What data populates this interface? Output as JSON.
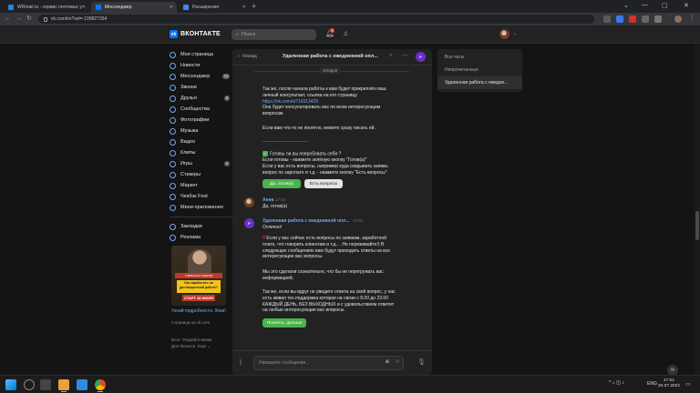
{
  "browser": {
    "tabs": [
      {
        "label": "WRmail.ru - сервис почтовых у",
        "active": false,
        "color": "#1e88e5"
      },
      {
        "label": "Мессенджер",
        "active": true,
        "color": "#0077ff"
      },
      {
        "label": "Расширения",
        "active": false,
        "color": "#4285f4"
      }
    ],
    "new_tab": "+",
    "url": "vk.com/im?sel=-199827354",
    "window_controls": [
      "—",
      "▢",
      "✕"
    ]
  },
  "vk_header": {
    "logo": "ВКОНТАКТЕ",
    "search_placeholder": "Поиск",
    "notifications_count": "1"
  },
  "sidebar": {
    "items": [
      {
        "label": "Моя страница",
        "badge": ""
      },
      {
        "label": "Новости",
        "badge": ""
      },
      {
        "label": "Мессенджер",
        "badge": "74"
      },
      {
        "label": "Звонки",
        "badge": ""
      },
      {
        "label": "Друзья",
        "badge": "8"
      },
      {
        "label": "Сообщества",
        "badge": ""
      },
      {
        "label": "Фотографии",
        "badge": ""
      },
      {
        "label": "Музыка",
        "badge": ""
      },
      {
        "label": "Видео",
        "badge": ""
      },
      {
        "label": "Клипы",
        "badge": ""
      },
      {
        "label": "Игры",
        "badge": "2"
      },
      {
        "label": "Стикеры",
        "badge": ""
      },
      {
        "label": "Маркет",
        "badge": ""
      },
      {
        "label": "Чекбэк Fest",
        "badge": ""
      },
      {
        "label": "Мини-приложения",
        "badge": ""
      }
    ],
    "items2": [
      {
        "label": "Закладки"
      },
      {
        "label": "Реклама"
      }
    ],
    "ad": {
      "banner_top": "2 ВЕБИНАР ПОДРЯД",
      "banner_mid": "Как заработать на дистанционной работе?",
      "banner_bottom": "СТАРТ 25 ИЮЛЯ",
      "link": "Узнай подробности. Жми!",
      "source": "Страница на vk.com"
    },
    "footer": {
      "l1a": "Блог",
      "l1b": "Разработчикам",
      "l2a": "Для бизнеса",
      "l2b": "Ещё ⌄"
    }
  },
  "chat": {
    "back_label": "Назад",
    "title": "Удаленная работа с ежедневной опл...",
    "avatar_letter": "P",
    "date_label": "сегодня",
    "msg1": {
      "lines": [
        "Так же, после начала работы к вам будет прикреплён ваш",
        "личный консультант, ссылка на его страницу"
      ],
      "link": "https://vk.com/id716013425",
      "lines2": [
        "Она будет консультировать вас по всем интересующим",
        "вопросам."
      ],
      "line3": "Если вам что-то не понятно, можете сразу писать ей.",
      "divider": "__________________",
      "check_line": "Готовы ли вы попробовать себя ?",
      "lines4": [
        "Если готовы - нажмите зелёную кнопку \"Готов(а)\"",
        "Если у вас есть вопросы, например куда скидывать заявки,",
        "вопрос по зарплате и т.д. - нажмите кнопку \"Есть вопросы\""
      ],
      "btn_ready": "Да, готов(а)",
      "btn_questions": "Есть вопросы"
    },
    "msg2": {
      "author": "Анна",
      "time": "17:01",
      "text": "Да, готов(а)"
    },
    "msg3": {
      "author": "Удаленная работа с ежедневной опл...",
      "time": "17:01",
      "text": "Отлично!",
      "para1": [
        "Если у вас сейчас есть вопросы по заявкам, заработной",
        "плате, что говорить клиентам и т.д.. . Не переживайте!) В",
        "следующих сообщениях вам будут приходить ответы на все",
        "интересующие вас вопросы."
      ],
      "para2": [
        "Мы это сделали сознательно, что бы не перегружать вас",
        "информацией."
      ],
      "para3": [
        "Так же, если вы вдруг не увидите ответа на свой вопрос, у нас",
        "есть живая тех.поддержка которая на связи с 8.00 до 23.00",
        "КАЖДЫЙ ДЕНЬ, БЕЗ ВЫХОДНЫХ и с удовольствием ответит",
        "на любые интересующие вас вопросы."
      ],
      "button": "Понятно, дальше"
    },
    "composer_placeholder": "Напишите сообщение..."
  },
  "filters": {
    "items": [
      {
        "label": "Все чаты",
        "selected": false
      },
      {
        "label": "Непрочитанные",
        "selected": false
      },
      {
        "label": "Удаленная работа с ежедне...",
        "selected": true
      }
    ]
  },
  "taskbar": {
    "tray": "^ ⌂ ◫ ♪",
    "lang": "ENG",
    "time": "17:01",
    "date": "20.07.2022"
  }
}
